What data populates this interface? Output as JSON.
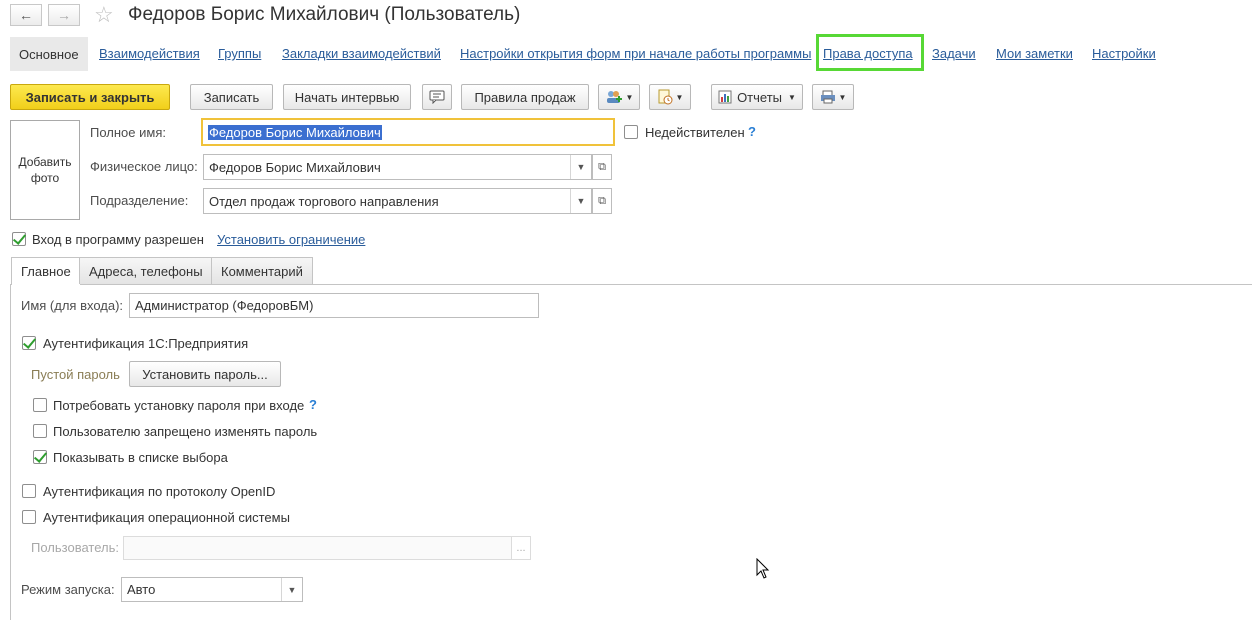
{
  "window": {
    "title": "Федоров Борис Михайлович (Пользователь)",
    "back_icon": "arrow-left",
    "forward_icon": "arrow-right",
    "favorite_icon": "star"
  },
  "nav": {
    "active": "Основное",
    "links": [
      "Взаимодействия",
      "Группы",
      "Закладки взаимодействий",
      "Настройки открытия форм при начале работы программы",
      "Права доступа",
      "Задачи",
      "Мои заметки",
      "Настройки"
    ],
    "highlight_color": "#57d835"
  },
  "toolbar": {
    "save_close": "Записать и закрыть",
    "save": "Записать",
    "start_interview": "Начать интервью",
    "sales_rules": "Правила продаж",
    "reports": "Отчеты",
    "accent_color": "#f4d82a"
  },
  "photo": {
    "label": "Добавить фото"
  },
  "form": {
    "full_name_label": "Полное имя:",
    "full_name_value": "Федоров Борис Михайлович",
    "invalid_label": "Недействителен",
    "help": "?",
    "person_label": "Физическое лицо:",
    "person_value": "Федоров Борис Михайлович",
    "department_label": "Подразделение:",
    "department_value": "Отдел продаж торгового направления",
    "login_allowed_label": "Вход в программу разрешен",
    "set_restriction_link": "Установить ограничение"
  },
  "tabs": [
    "Главное",
    "Адреса, телефоны",
    "Комментарий"
  ],
  "main_tab": {
    "login_name_label": "Имя (для входа):",
    "login_name_value": "Администратор (ФедоровБМ)",
    "auth_1c_label": "Аутентификация 1С:Предприятия",
    "empty_password_label": "Пустой пароль",
    "set_password_button": "Установить пароль...",
    "require_password_label": "Потребовать установку пароля при входе",
    "forbid_change_label": "Пользователю запрещено изменять пароль",
    "show_in_list_label": "Показывать в списке выбора",
    "openid_label": "Аутентификация по протоколу OpenID",
    "os_auth_label": "Аутентификация операционной системы",
    "os_user_label": "Пользователь:",
    "os_user_value": "",
    "os_user_ellipsis": "...",
    "launch_mode_label": "Режим запуска:",
    "launch_mode_value": "Авто"
  }
}
